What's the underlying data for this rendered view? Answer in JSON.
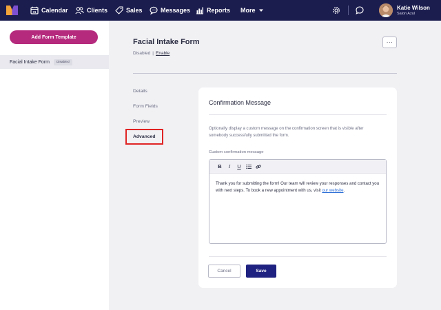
{
  "nav": {
    "items": [
      {
        "label": "Calendar",
        "icon": "calendar-icon"
      },
      {
        "label": "Clients",
        "icon": "clients-icon"
      },
      {
        "label": "Sales",
        "icon": "sales-tag-icon"
      },
      {
        "label": "Messages",
        "icon": "messages-icon"
      },
      {
        "label": "Reports",
        "icon": "reports-icon"
      }
    ],
    "more_label": "More",
    "user": {
      "name": "Katie Wilson",
      "org": "Salon Azul"
    },
    "colors": {
      "bar": "#1c1d4f",
      "logo_primary": "#f2a33a",
      "logo_secondary": "#7d4fd1"
    }
  },
  "sidebar": {
    "add_button_label": "Add Form Template",
    "form_items": [
      {
        "label": "Facial Intake Form",
        "badge": "Disabled"
      }
    ]
  },
  "main": {
    "title": "Facial Intake Form",
    "status": "Disabled",
    "status_separator": "|",
    "enable_label": "Enable",
    "more_menu_label": "···",
    "subnav": [
      {
        "label": "Details"
      },
      {
        "label": "Form Fields"
      },
      {
        "label": "Preview"
      },
      {
        "label": "Advanced",
        "active": true
      }
    ]
  },
  "card": {
    "title": "Confirmation Message",
    "description": "Optionally display a custom message on the confirmation screen that is visible after somebody successfully submitted the form.",
    "field_label": "Custom confirmation message",
    "toolbar": [
      "B",
      "I",
      "U",
      "list-icon",
      "link-icon"
    ],
    "message_text": "Thank you for submitting the form! Our team will review your responses and contact you with next steps. To book a new appointment with us, visit ",
    "message_link": "our website",
    "message_end": ".",
    "cancel_label": "Cancel",
    "save_label": "Save"
  },
  "colors": {
    "accent_pink": "#b52a7d",
    "save_blue": "#1f2280",
    "link_blue": "#2d6fd6",
    "highlight_red": "#e02424"
  }
}
